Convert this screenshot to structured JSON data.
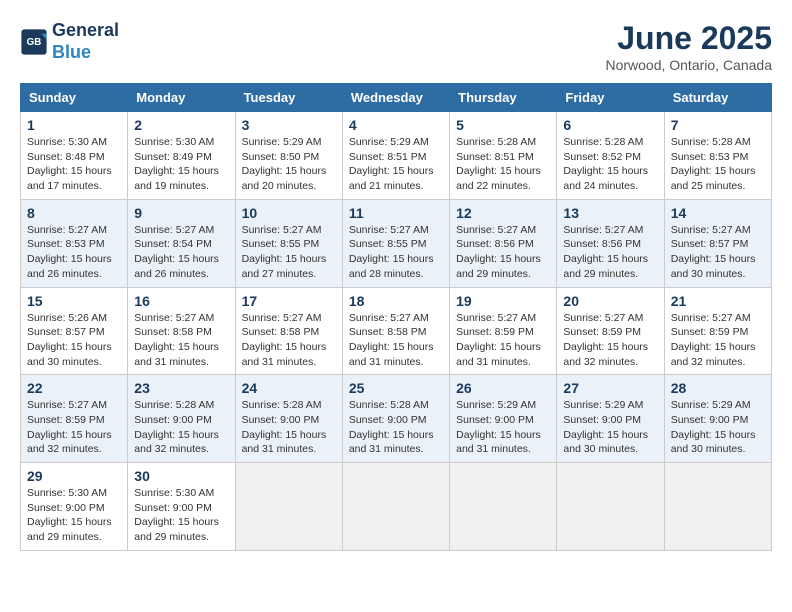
{
  "logo": {
    "line1": "General",
    "line2": "Blue"
  },
  "title": "June 2025",
  "location": "Norwood, Ontario, Canada",
  "headers": [
    "Sunday",
    "Monday",
    "Tuesday",
    "Wednesday",
    "Thursday",
    "Friday",
    "Saturday"
  ],
  "weeks": [
    [
      {
        "day": "1",
        "info": "Sunrise: 5:30 AM\nSunset: 8:48 PM\nDaylight: 15 hours\nand 17 minutes."
      },
      {
        "day": "2",
        "info": "Sunrise: 5:30 AM\nSunset: 8:49 PM\nDaylight: 15 hours\nand 19 minutes."
      },
      {
        "day": "3",
        "info": "Sunrise: 5:29 AM\nSunset: 8:50 PM\nDaylight: 15 hours\nand 20 minutes."
      },
      {
        "day": "4",
        "info": "Sunrise: 5:29 AM\nSunset: 8:51 PM\nDaylight: 15 hours\nand 21 minutes."
      },
      {
        "day": "5",
        "info": "Sunrise: 5:28 AM\nSunset: 8:51 PM\nDaylight: 15 hours\nand 22 minutes."
      },
      {
        "day": "6",
        "info": "Sunrise: 5:28 AM\nSunset: 8:52 PM\nDaylight: 15 hours\nand 24 minutes."
      },
      {
        "day": "7",
        "info": "Sunrise: 5:28 AM\nSunset: 8:53 PM\nDaylight: 15 hours\nand 25 minutes."
      }
    ],
    [
      {
        "day": "8",
        "info": "Sunrise: 5:27 AM\nSunset: 8:53 PM\nDaylight: 15 hours\nand 26 minutes."
      },
      {
        "day": "9",
        "info": "Sunrise: 5:27 AM\nSunset: 8:54 PM\nDaylight: 15 hours\nand 26 minutes."
      },
      {
        "day": "10",
        "info": "Sunrise: 5:27 AM\nSunset: 8:55 PM\nDaylight: 15 hours\nand 27 minutes."
      },
      {
        "day": "11",
        "info": "Sunrise: 5:27 AM\nSunset: 8:55 PM\nDaylight: 15 hours\nand 28 minutes."
      },
      {
        "day": "12",
        "info": "Sunrise: 5:27 AM\nSunset: 8:56 PM\nDaylight: 15 hours\nand 29 minutes."
      },
      {
        "day": "13",
        "info": "Sunrise: 5:27 AM\nSunset: 8:56 PM\nDaylight: 15 hours\nand 29 minutes."
      },
      {
        "day": "14",
        "info": "Sunrise: 5:27 AM\nSunset: 8:57 PM\nDaylight: 15 hours\nand 30 minutes."
      }
    ],
    [
      {
        "day": "15",
        "info": "Sunrise: 5:26 AM\nSunset: 8:57 PM\nDaylight: 15 hours\nand 30 minutes."
      },
      {
        "day": "16",
        "info": "Sunrise: 5:27 AM\nSunset: 8:58 PM\nDaylight: 15 hours\nand 31 minutes."
      },
      {
        "day": "17",
        "info": "Sunrise: 5:27 AM\nSunset: 8:58 PM\nDaylight: 15 hours\nand 31 minutes."
      },
      {
        "day": "18",
        "info": "Sunrise: 5:27 AM\nSunset: 8:58 PM\nDaylight: 15 hours\nand 31 minutes."
      },
      {
        "day": "19",
        "info": "Sunrise: 5:27 AM\nSunset: 8:59 PM\nDaylight: 15 hours\nand 31 minutes."
      },
      {
        "day": "20",
        "info": "Sunrise: 5:27 AM\nSunset: 8:59 PM\nDaylight: 15 hours\nand 32 minutes."
      },
      {
        "day": "21",
        "info": "Sunrise: 5:27 AM\nSunset: 8:59 PM\nDaylight: 15 hours\nand 32 minutes."
      }
    ],
    [
      {
        "day": "22",
        "info": "Sunrise: 5:27 AM\nSunset: 8:59 PM\nDaylight: 15 hours\nand 32 minutes."
      },
      {
        "day": "23",
        "info": "Sunrise: 5:28 AM\nSunset: 9:00 PM\nDaylight: 15 hours\nand 32 minutes."
      },
      {
        "day": "24",
        "info": "Sunrise: 5:28 AM\nSunset: 9:00 PM\nDaylight: 15 hours\nand 31 minutes."
      },
      {
        "day": "25",
        "info": "Sunrise: 5:28 AM\nSunset: 9:00 PM\nDaylight: 15 hours\nand 31 minutes."
      },
      {
        "day": "26",
        "info": "Sunrise: 5:29 AM\nSunset: 9:00 PM\nDaylight: 15 hours\nand 31 minutes."
      },
      {
        "day": "27",
        "info": "Sunrise: 5:29 AM\nSunset: 9:00 PM\nDaylight: 15 hours\nand 30 minutes."
      },
      {
        "day": "28",
        "info": "Sunrise: 5:29 AM\nSunset: 9:00 PM\nDaylight: 15 hours\nand 30 minutes."
      }
    ],
    [
      {
        "day": "29",
        "info": "Sunrise: 5:30 AM\nSunset: 9:00 PM\nDaylight: 15 hours\nand 29 minutes."
      },
      {
        "day": "30",
        "info": "Sunrise: 5:30 AM\nSunset: 9:00 PM\nDaylight: 15 hours\nand 29 minutes."
      },
      {
        "day": "",
        "info": ""
      },
      {
        "day": "",
        "info": ""
      },
      {
        "day": "",
        "info": ""
      },
      {
        "day": "",
        "info": ""
      },
      {
        "day": "",
        "info": ""
      }
    ]
  ]
}
